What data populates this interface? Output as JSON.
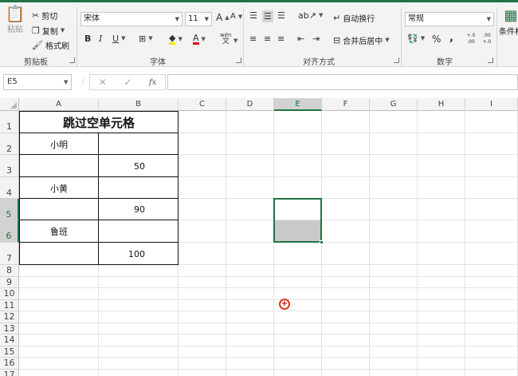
{
  "ribbon": {
    "clipboard": {
      "paste": "粘贴",
      "cut": "剪切",
      "copy": "复制",
      "format_painter": "格式刷",
      "label": "剪贴板"
    },
    "font": {
      "name": "宋体",
      "size": "11",
      "bold": "B",
      "italic": "I",
      "underline": "U",
      "grow": "A",
      "shrink": "A",
      "phonetic_top": "wén",
      "phonetic_bottom": "文",
      "font_color": "A",
      "label": "字体"
    },
    "alignment": {
      "wrap": "自动换行",
      "merge": "合并后居中",
      "label": "对齐方式"
    },
    "number": {
      "format": "常规",
      "percent": "%",
      "comma": ",",
      "inc_decimal": "+.0 .00",
      "dec_decimal": ".00 +.0",
      "label": "数字"
    },
    "styles": {
      "conditional": "条件格"
    }
  },
  "formula_bar": {
    "name_box": "E5",
    "cancel": "✕",
    "enter": "✓",
    "fx": "fx",
    "value": ""
  },
  "sheet": {
    "columns": [
      "A",
      "B",
      "C",
      "D",
      "E",
      "F",
      "G",
      "H",
      "I"
    ],
    "rows": [
      "1",
      "2",
      "3",
      "4",
      "5",
      "6",
      "7",
      "8",
      "9",
      "10",
      "11",
      "12",
      "13",
      "14",
      "15",
      "16",
      "17"
    ],
    "selected_column": "E",
    "selected_rows": [
      "5",
      "6"
    ],
    "title": "跳过空单元格",
    "cells": {
      "A2": "小明",
      "B3": "50",
      "A4": "小黄",
      "B5": "90",
      "A6": "鲁班",
      "B7": "100"
    }
  },
  "colors": {
    "accent": "#217346",
    "selection_fill": "#c9c9c9"
  }
}
